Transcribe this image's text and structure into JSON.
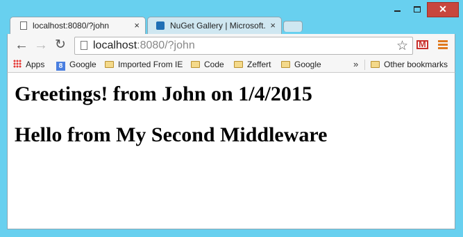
{
  "window": {
    "minimize_icon": "minimize-icon",
    "maximize_icon": "maximize-icon",
    "close_label": "✕"
  },
  "tabs": [
    {
      "title": "localhost:8080/?john",
      "close": "×",
      "active": true
    },
    {
      "title": "NuGet Gallery | Microsoft.",
      "close": "×",
      "active": false
    }
  ],
  "toolbar": {
    "back": "←",
    "forward": "→",
    "reload": "↻",
    "url_host": "localhost",
    "url_rest": ":8080/?john",
    "star": "☆"
  },
  "bookmarks": {
    "items": [
      "Apps",
      "Google",
      "Imported From IE",
      "Code",
      "Zeffert",
      "Google"
    ],
    "overflow": "»",
    "other": "Other bookmarks"
  },
  "page": {
    "heading1": "Greetings! from John on 1/4/2015",
    "heading2": "Hello from My Second Middleware"
  },
  "colors": {
    "frame": "#68d0ef",
    "close_button": "#c8463d"
  }
}
